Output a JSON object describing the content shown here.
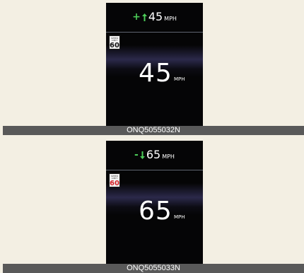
{
  "panels": [
    {
      "top_speed": "45",
      "top_sign": "+",
      "top_unit": "MPH",
      "arrow_direction": "up",
      "arrow_color": "#4ccb58",
      "limit_sign_label": "SPEED LIMIT",
      "limit_value": "60",
      "limit_color": "#111111",
      "big_speed": "45",
      "big_unit": "MPH",
      "caption": "ONQ5055032N"
    },
    {
      "top_speed": "65",
      "top_sign": "-",
      "top_unit": "MPH",
      "arrow_direction": "down",
      "arrow_color": "#4ccb58",
      "limit_sign_label": "SPEED LIMIT",
      "limit_value": "60",
      "limit_color": "#d4232a",
      "big_speed": "65",
      "big_unit": "MPH",
      "caption": "ONQ5055033N"
    }
  ]
}
